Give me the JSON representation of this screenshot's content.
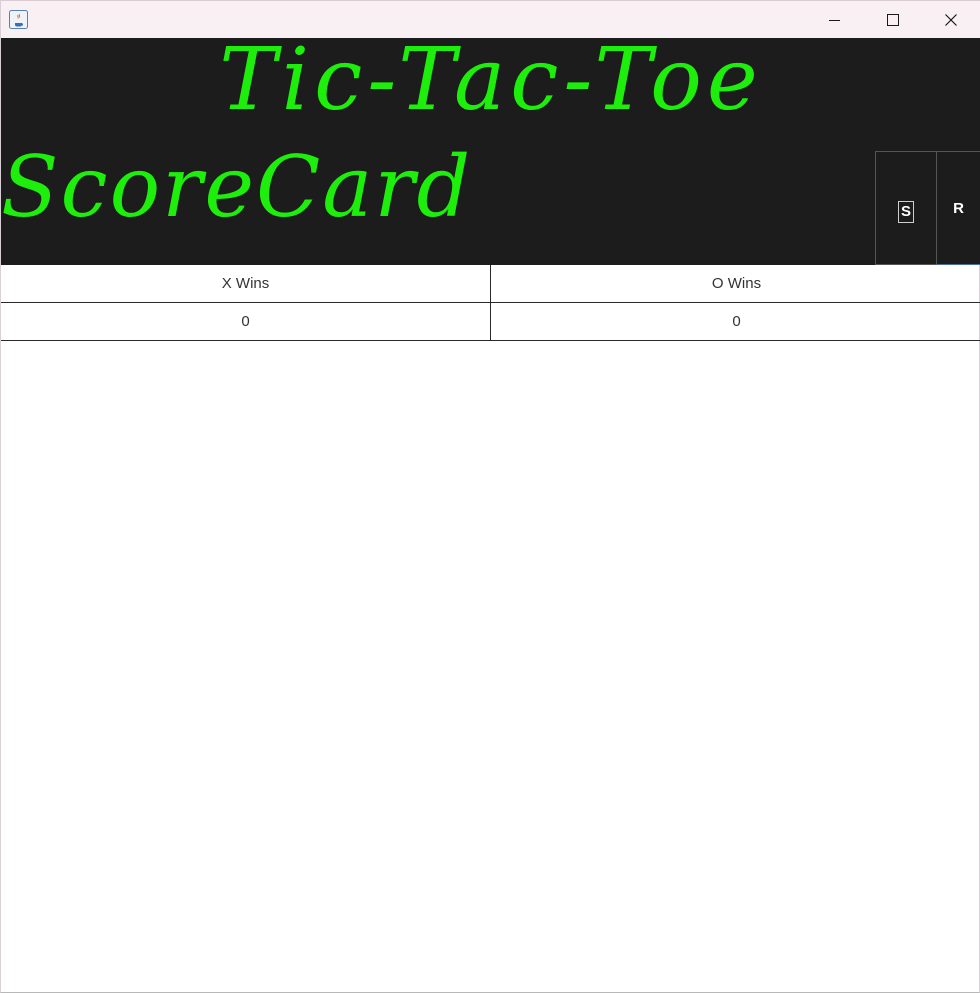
{
  "window": {
    "icon": "java-app-icon",
    "controls": {
      "minimize_icon": "minimize-icon",
      "maximize_icon": "maximize-icon",
      "close_icon": "close-icon"
    }
  },
  "header": {
    "title": "Tic-Tac-Toe",
    "subtitle": "ScoreCard",
    "text_color": "#1dee0b",
    "background": "#1c1c1c",
    "buttons": {
      "s_label": "S",
      "r_label": "R"
    }
  },
  "scoreboard": {
    "columns": [
      "X Wins",
      "O Wins"
    ],
    "rows": [
      [
        "0",
        "0"
      ]
    ]
  }
}
